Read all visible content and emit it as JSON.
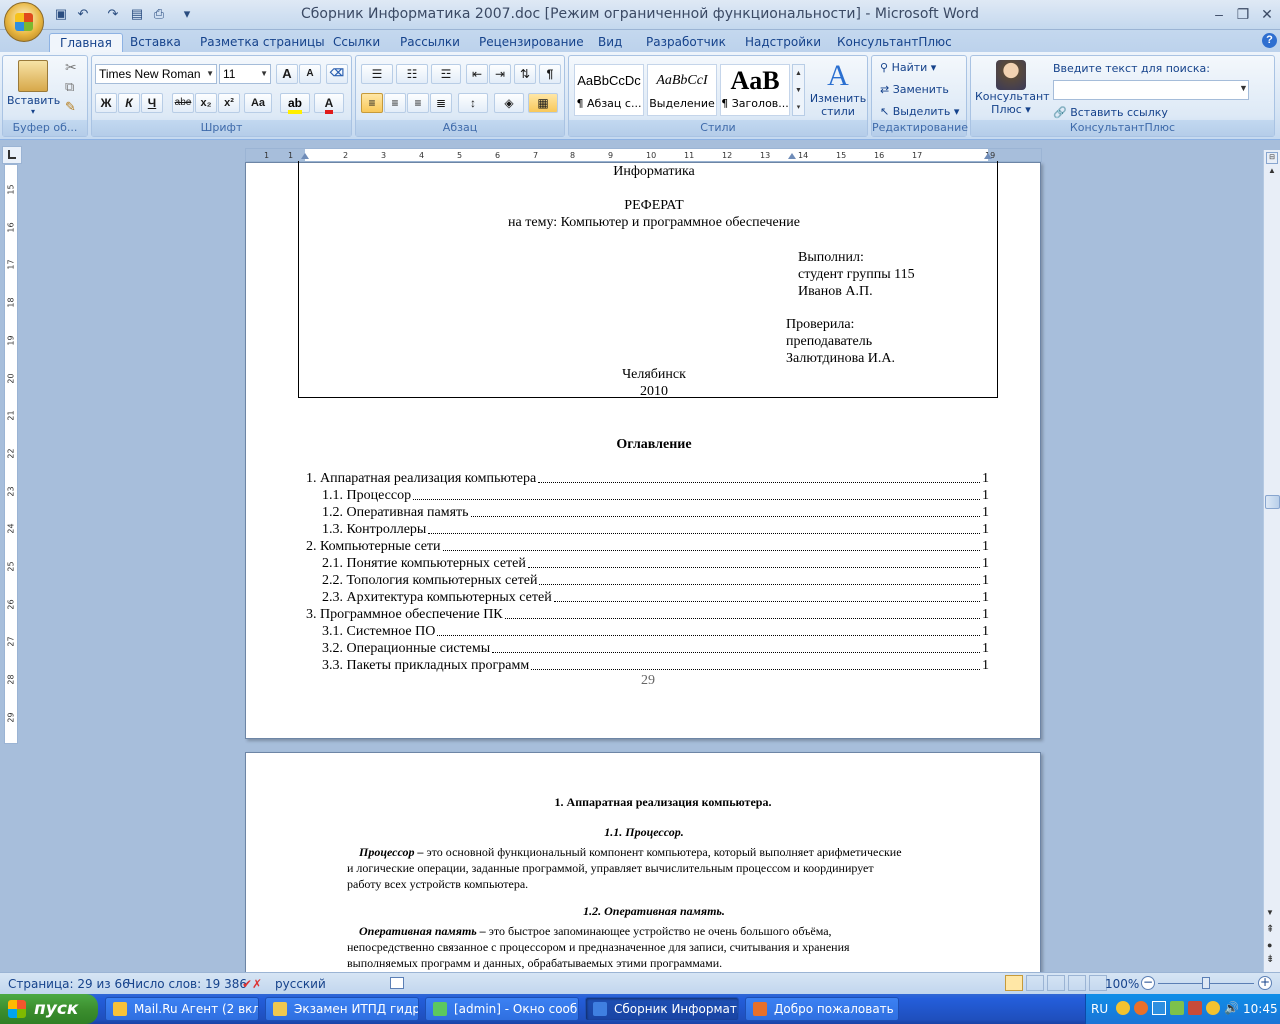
{
  "window": {
    "title": "Сборник Информатика 2007.doc [Режим ограниченной функциональности] - Microsoft Word",
    "minimize": "–",
    "restore": "❐",
    "close": "✕",
    "help": "?"
  },
  "tabs": [
    "Главная",
    "Вставка",
    "Разметка страницы",
    "Ссылки",
    "Рассылки",
    "Рецензирование",
    "Вид",
    "Разработчик",
    "Надстройки",
    "КонсультантПлюс"
  ],
  "ribbon": {
    "clipboard": {
      "label": "Буфер об...",
      "paste": "Вставить"
    },
    "font": {
      "label": "Шрифт",
      "name": "Times New Roman",
      "size": "11",
      "bold": "Ж",
      "italic": "К",
      "underline": "Ч",
      "strike": "abe",
      "sub": "x₂",
      "sup": "x²",
      "case": "Aa",
      "grow": "A",
      "shrink": "A"
    },
    "paragraph": {
      "label": "Абзац",
      "pilcrow": "¶"
    },
    "styles": {
      "label": "Стили",
      "tiles": [
        {
          "sample": "AaBbCcDc",
          "name": "¶ Абзац с..."
        },
        {
          "sample": "AaBbCcI",
          "name": "Выделение"
        },
        {
          "sample": "AaB",
          "name": "¶ Заголов..."
        }
      ],
      "change": "Изменить стили"
    },
    "editing": {
      "label": "Редактирование",
      "find": "Найти",
      "replace": "Заменить",
      "select": "Выделить"
    },
    "consultant": {
      "label": "КонсультантПлюс",
      "button": "Консультант Плюс",
      "search_label": "Введите текст для поиска:",
      "search_placeholder": "",
      "insert_link": "Вставить ссылку"
    }
  },
  "ruler_h": [
    "1",
    "1",
    "2",
    "3",
    "4",
    "5",
    "6",
    "7",
    "8",
    "9",
    "10",
    "11",
    "12",
    "13",
    "14",
    "15",
    "16",
    "17",
    "19"
  ],
  "ruler_v": [
    "15",
    "16",
    "17",
    "18",
    "19",
    "20",
    "21",
    "22",
    "23",
    "24",
    "25",
    "26",
    "27",
    "28",
    "29"
  ],
  "cover": {
    "subject": "Информатика",
    "doc_type": "РЕФЕРАТ",
    "topic": "на тему: Компьютер и программное обеспечение",
    "done_by": [
      "Выполнил:",
      "студент группы 115",
      "Иванов А.П."
    ],
    "checked_by": [
      "Проверила:",
      "преподаватель",
      "Залютдинова И.А."
    ],
    "city": "Челябинск",
    "year": "2010"
  },
  "toc": {
    "title": "Оглавление",
    "items": [
      {
        "text": "1. Аппаратная реализация компьютера",
        "page": "1",
        "level": 1
      },
      {
        "text": "1.1. Процессор",
        "page": "1",
        "level": 2
      },
      {
        "text": "1.2. Оперативная память",
        "page": "1",
        "level": 2
      },
      {
        "text": "1.3. Контроллеры",
        "page": "1",
        "level": 2
      },
      {
        "text": "2. Компьютерные сети",
        "page": "1",
        "level": 1
      },
      {
        "text": "2.1. Понятие компьютерных сетей",
        "page": "1",
        "level": 2
      },
      {
        "text": "2.2. Топология компьютерных сетей",
        "page": "1",
        "level": 2
      },
      {
        "text": "2.3. Архитектура компьютерных сетей",
        "page": "1",
        "level": 2
      },
      {
        "text": "3. Программное обеспечение ПК",
        "page": "1",
        "level": 1
      },
      {
        "text": "3.1. Системное ПО",
        "page": "1",
        "level": 2
      },
      {
        "text": "3.2. Операционные системы",
        "page": "1",
        "level": 2
      },
      {
        "text": "3.3. Пакеты прикладных программ",
        "page": "1",
        "level": 2
      }
    ],
    "page_number": "29"
  },
  "page2": {
    "heading": "1. Аппаратная реализация компьютера.",
    "sub1": "1.1. Процессор.",
    "p1_term": "Процессор –",
    "p1_lines": [
      " это основной функциональный компонент компьютера, который выполняет арифметические",
      "и логические операции, заданные программой, управляет вычислительным процессом и координирует",
      "работу всех устройств компьютера."
    ],
    "sub2": "1.2. Оперативная память.",
    "p2_term": "Оперативная память –",
    "p2_lines": [
      " это быстрое запоминающее устройство не очень большого объёма,",
      "непосредственно связанное с процессором и предназначенное для записи, считывания и хранения",
      "выполняемых программ и данных, обрабатываемых этими программами."
    ]
  },
  "status": {
    "page": "Страница: 29 из 66",
    "words": "Число слов: 19 386",
    "lang": "русский",
    "zoom": "100%",
    "zoom_level": 0.5
  },
  "taskbar": {
    "start": "пуск",
    "buttons": [
      {
        "label": "Mail.Ru Агент (2 вкл...",
        "color": "#f7c23a"
      },
      {
        "label": "Экзамен ИТПД гидр...",
        "color": "#f0c850"
      },
      {
        "label": "[admin] - Окно сооб...",
        "color": "#5cc860"
      },
      {
        "label": "Сборник Информати...",
        "color": "#3f7fe0"
      },
      {
        "label": "Добро пожаловать -...",
        "color": "#e8702a"
      }
    ],
    "lang": "RU",
    "clock": "10:45"
  }
}
